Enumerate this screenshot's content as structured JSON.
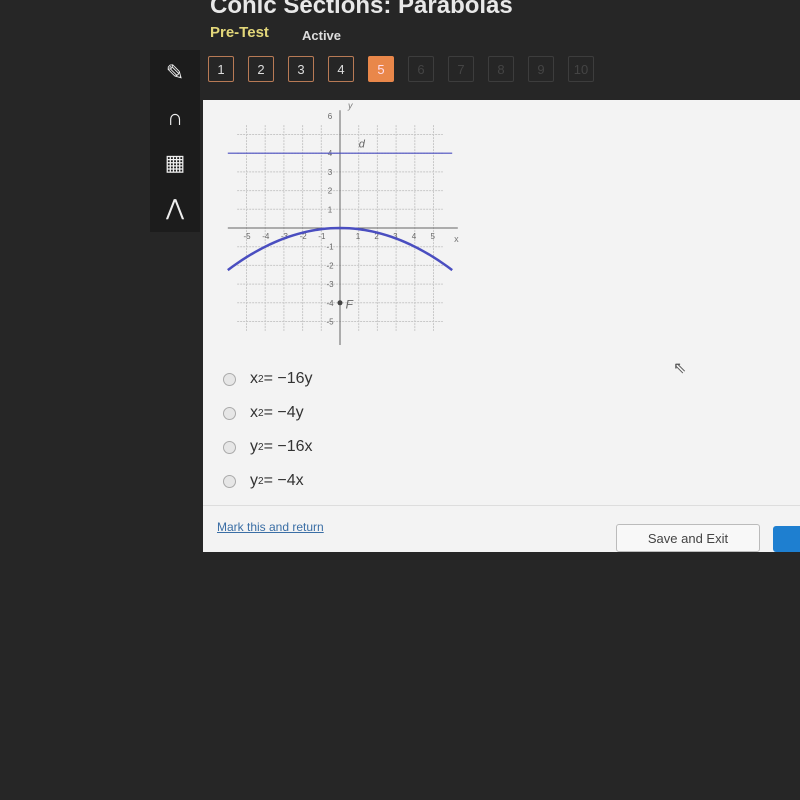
{
  "header": {
    "title": "Conic Sections: Parabolas",
    "subtitle": "Pre-Test",
    "status": "Active"
  },
  "questions": [
    {
      "label": "1",
      "state": "done"
    },
    {
      "label": "2",
      "state": "done"
    },
    {
      "label": "3",
      "state": "done"
    },
    {
      "label": "4",
      "state": "done"
    },
    {
      "label": "5",
      "state": "current"
    },
    {
      "label": "6",
      "state": "locked"
    },
    {
      "label": "7",
      "state": "locked"
    },
    {
      "label": "8",
      "state": "locked"
    },
    {
      "label": "9",
      "state": "locked"
    },
    {
      "label": "10",
      "state": "locked"
    }
  ],
  "tools": [
    {
      "icon": "pencil-icon",
      "glyph": "✎"
    },
    {
      "icon": "headphones-icon",
      "glyph": "∩"
    },
    {
      "icon": "calculator-icon",
      "glyph": "▦"
    },
    {
      "icon": "arrow-up-icon",
      "glyph": "⋀"
    }
  ],
  "graph": {
    "x_label": "x",
    "y_label": "y",
    "directrix_label": "d",
    "focus_label": "F",
    "directrix_y": 4,
    "focus": [
      0,
      -4
    ],
    "parabola": "x^2=-16y",
    "range": [
      -6,
      6
    ],
    "x_ticks": [
      "-5",
      "-4",
      "-3",
      "-2",
      "-1",
      "1",
      "2",
      "3",
      "4",
      "5"
    ],
    "y_ticks": [
      "6",
      "4",
      "3",
      "2",
      "1",
      "-1",
      "-2",
      "-3",
      "-4",
      "-5"
    ],
    "colors": {
      "curve": "#4a4ec0",
      "grid": "#c8c8c8"
    }
  },
  "choices": [
    {
      "base": "x",
      "exp": "2",
      "rest": " = −16y"
    },
    {
      "base": "x",
      "exp": "2",
      "rest": " = −4y"
    },
    {
      "base": "y",
      "exp": "2",
      "rest": " = −16x"
    },
    {
      "base": "y",
      "exp": "2",
      "rest": " = −4x"
    }
  ],
  "footer": {
    "mark_label": "Mark this and return",
    "save_label": "Save and Exit"
  }
}
